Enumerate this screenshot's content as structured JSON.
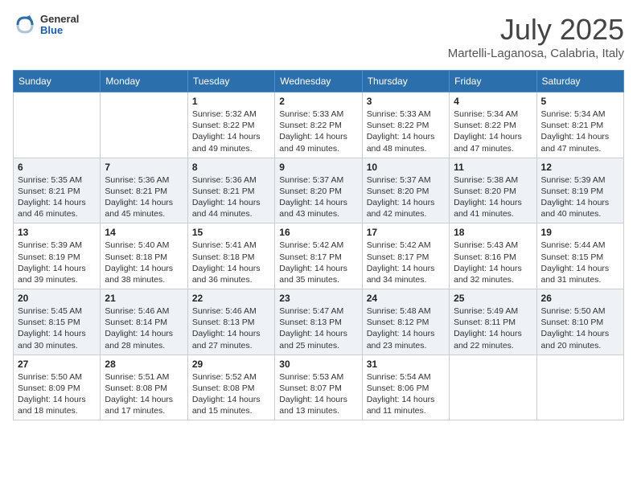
{
  "header": {
    "logo": {
      "general": "General",
      "blue": "Blue"
    },
    "title": "July 2025",
    "location": "Martelli-Laganosa, Calabria, Italy"
  },
  "weekdays": [
    "Sunday",
    "Monday",
    "Tuesday",
    "Wednesday",
    "Thursday",
    "Friday",
    "Saturday"
  ],
  "weeks": [
    [
      {
        "day": "",
        "sunrise": "",
        "sunset": "",
        "daylight": ""
      },
      {
        "day": "",
        "sunrise": "",
        "sunset": "",
        "daylight": ""
      },
      {
        "day": "1",
        "sunrise": "Sunrise: 5:32 AM",
        "sunset": "Sunset: 8:22 PM",
        "daylight": "Daylight: 14 hours and 49 minutes."
      },
      {
        "day": "2",
        "sunrise": "Sunrise: 5:33 AM",
        "sunset": "Sunset: 8:22 PM",
        "daylight": "Daylight: 14 hours and 49 minutes."
      },
      {
        "day": "3",
        "sunrise": "Sunrise: 5:33 AM",
        "sunset": "Sunset: 8:22 PM",
        "daylight": "Daylight: 14 hours and 48 minutes."
      },
      {
        "day": "4",
        "sunrise": "Sunrise: 5:34 AM",
        "sunset": "Sunset: 8:22 PM",
        "daylight": "Daylight: 14 hours and 47 minutes."
      },
      {
        "day": "5",
        "sunrise": "Sunrise: 5:34 AM",
        "sunset": "Sunset: 8:21 PM",
        "daylight": "Daylight: 14 hours and 47 minutes."
      }
    ],
    [
      {
        "day": "6",
        "sunrise": "Sunrise: 5:35 AM",
        "sunset": "Sunset: 8:21 PM",
        "daylight": "Daylight: 14 hours and 46 minutes."
      },
      {
        "day": "7",
        "sunrise": "Sunrise: 5:36 AM",
        "sunset": "Sunset: 8:21 PM",
        "daylight": "Daylight: 14 hours and 45 minutes."
      },
      {
        "day": "8",
        "sunrise": "Sunrise: 5:36 AM",
        "sunset": "Sunset: 8:21 PM",
        "daylight": "Daylight: 14 hours and 44 minutes."
      },
      {
        "day": "9",
        "sunrise": "Sunrise: 5:37 AM",
        "sunset": "Sunset: 8:20 PM",
        "daylight": "Daylight: 14 hours and 43 minutes."
      },
      {
        "day": "10",
        "sunrise": "Sunrise: 5:37 AM",
        "sunset": "Sunset: 8:20 PM",
        "daylight": "Daylight: 14 hours and 42 minutes."
      },
      {
        "day": "11",
        "sunrise": "Sunrise: 5:38 AM",
        "sunset": "Sunset: 8:20 PM",
        "daylight": "Daylight: 14 hours and 41 minutes."
      },
      {
        "day": "12",
        "sunrise": "Sunrise: 5:39 AM",
        "sunset": "Sunset: 8:19 PM",
        "daylight": "Daylight: 14 hours and 40 minutes."
      }
    ],
    [
      {
        "day": "13",
        "sunrise": "Sunrise: 5:39 AM",
        "sunset": "Sunset: 8:19 PM",
        "daylight": "Daylight: 14 hours and 39 minutes."
      },
      {
        "day": "14",
        "sunrise": "Sunrise: 5:40 AM",
        "sunset": "Sunset: 8:18 PM",
        "daylight": "Daylight: 14 hours and 38 minutes."
      },
      {
        "day": "15",
        "sunrise": "Sunrise: 5:41 AM",
        "sunset": "Sunset: 8:18 PM",
        "daylight": "Daylight: 14 hours and 36 minutes."
      },
      {
        "day": "16",
        "sunrise": "Sunrise: 5:42 AM",
        "sunset": "Sunset: 8:17 PM",
        "daylight": "Daylight: 14 hours and 35 minutes."
      },
      {
        "day": "17",
        "sunrise": "Sunrise: 5:42 AM",
        "sunset": "Sunset: 8:17 PM",
        "daylight": "Daylight: 14 hours and 34 minutes."
      },
      {
        "day": "18",
        "sunrise": "Sunrise: 5:43 AM",
        "sunset": "Sunset: 8:16 PM",
        "daylight": "Daylight: 14 hours and 32 minutes."
      },
      {
        "day": "19",
        "sunrise": "Sunrise: 5:44 AM",
        "sunset": "Sunset: 8:15 PM",
        "daylight": "Daylight: 14 hours and 31 minutes."
      }
    ],
    [
      {
        "day": "20",
        "sunrise": "Sunrise: 5:45 AM",
        "sunset": "Sunset: 8:15 PM",
        "daylight": "Daylight: 14 hours and 30 minutes."
      },
      {
        "day": "21",
        "sunrise": "Sunrise: 5:46 AM",
        "sunset": "Sunset: 8:14 PM",
        "daylight": "Daylight: 14 hours and 28 minutes."
      },
      {
        "day": "22",
        "sunrise": "Sunrise: 5:46 AM",
        "sunset": "Sunset: 8:13 PM",
        "daylight": "Daylight: 14 hours and 27 minutes."
      },
      {
        "day": "23",
        "sunrise": "Sunrise: 5:47 AM",
        "sunset": "Sunset: 8:13 PM",
        "daylight": "Daylight: 14 hours and 25 minutes."
      },
      {
        "day": "24",
        "sunrise": "Sunrise: 5:48 AM",
        "sunset": "Sunset: 8:12 PM",
        "daylight": "Daylight: 14 hours and 23 minutes."
      },
      {
        "day": "25",
        "sunrise": "Sunrise: 5:49 AM",
        "sunset": "Sunset: 8:11 PM",
        "daylight": "Daylight: 14 hours and 22 minutes."
      },
      {
        "day": "26",
        "sunrise": "Sunrise: 5:50 AM",
        "sunset": "Sunset: 8:10 PM",
        "daylight": "Daylight: 14 hours and 20 minutes."
      }
    ],
    [
      {
        "day": "27",
        "sunrise": "Sunrise: 5:50 AM",
        "sunset": "Sunset: 8:09 PM",
        "daylight": "Daylight: 14 hours and 18 minutes."
      },
      {
        "day": "28",
        "sunrise": "Sunrise: 5:51 AM",
        "sunset": "Sunset: 8:08 PM",
        "daylight": "Daylight: 14 hours and 17 minutes."
      },
      {
        "day": "29",
        "sunrise": "Sunrise: 5:52 AM",
        "sunset": "Sunset: 8:08 PM",
        "daylight": "Daylight: 14 hours and 15 minutes."
      },
      {
        "day": "30",
        "sunrise": "Sunrise: 5:53 AM",
        "sunset": "Sunset: 8:07 PM",
        "daylight": "Daylight: 14 hours and 13 minutes."
      },
      {
        "day": "31",
        "sunrise": "Sunrise: 5:54 AM",
        "sunset": "Sunset: 8:06 PM",
        "daylight": "Daylight: 14 hours and 11 minutes."
      },
      {
        "day": "",
        "sunrise": "",
        "sunset": "",
        "daylight": ""
      },
      {
        "day": "",
        "sunrise": "",
        "sunset": "",
        "daylight": ""
      }
    ]
  ]
}
